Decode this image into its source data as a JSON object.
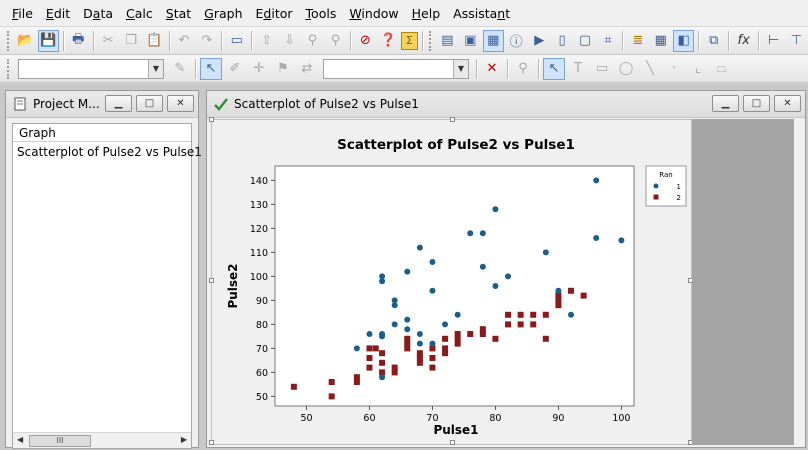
{
  "menubar": {
    "items": [
      {
        "pre": "",
        "u": "F",
        "post": "ile"
      },
      {
        "pre": "",
        "u": "E",
        "post": "dit"
      },
      {
        "pre": "D",
        "u": "a",
        "post": "ta"
      },
      {
        "pre": "",
        "u": "C",
        "post": "alc"
      },
      {
        "pre": "",
        "u": "S",
        "post": "tat"
      },
      {
        "pre": "",
        "u": "G",
        "post": "raph"
      },
      {
        "pre": "E",
        "u": "d",
        "post": "itor"
      },
      {
        "pre": "",
        "u": "T",
        "post": "ools"
      },
      {
        "pre": "",
        "u": "W",
        "post": "indow"
      },
      {
        "pre": "",
        "u": "H",
        "post": "elp"
      },
      {
        "pre": "Assista",
        "u": "n",
        "post": "t"
      }
    ]
  },
  "project_manager": {
    "title": "Project M...",
    "header": "Graph",
    "items": [
      "Scatterplot of Pulse2 vs Pulse1"
    ],
    "scroll_thumb": "III"
  },
  "graph_window": {
    "title": "Scatterplot of Pulse2 vs Pulse1"
  },
  "colors": {
    "series1": "#1a5e8c",
    "series2": "#8b1a1a"
  },
  "chart_data": {
    "type": "scatter",
    "title": "Scatterplot of Pulse2 vs Pulse1",
    "xlabel": "Pulse1",
    "ylabel": "Pulse2",
    "xlim": [
      45,
      102
    ],
    "ylim": [
      46,
      146
    ],
    "xticks": [
      50,
      60,
      70,
      80,
      90,
      100
    ],
    "yticks": [
      50,
      60,
      70,
      80,
      90,
      100,
      110,
      120,
      130,
      140
    ],
    "legend": {
      "title": "Ran",
      "placement": "right"
    },
    "series": [
      {
        "name": "1",
        "marker": "circle",
        "points": [
          [
            58,
            70
          ],
          [
            60,
            76
          ],
          [
            62,
            58
          ],
          [
            62,
            76
          ],
          [
            62,
            75
          ],
          [
            62,
            98
          ],
          [
            62,
            100
          ],
          [
            64,
            80
          ],
          [
            64,
            88
          ],
          [
            64,
            90
          ],
          [
            66,
            82
          ],
          [
            66,
            78
          ],
          [
            66,
            102
          ],
          [
            68,
            76
          ],
          [
            68,
            72
          ],
          [
            68,
            112
          ],
          [
            70,
            72
          ],
          [
            70,
            94
          ],
          [
            70,
            106
          ],
          [
            72,
            80
          ],
          [
            74,
            84
          ],
          [
            76,
            118
          ],
          [
            78,
            118
          ],
          [
            78,
            104
          ],
          [
            80,
            96
          ],
          [
            80,
            128
          ],
          [
            82,
            100
          ],
          [
            88,
            110
          ],
          [
            90,
            94
          ],
          [
            92,
            84
          ],
          [
            96,
            116
          ],
          [
            96,
            140
          ],
          [
            100,
            115
          ]
        ]
      },
      {
        "name": "2",
        "marker": "square",
        "points": [
          [
            48,
            54
          ],
          [
            54,
            50
          ],
          [
            54,
            56
          ],
          [
            58,
            56
          ],
          [
            58,
            58
          ],
          [
            60,
            62
          ],
          [
            60,
            66
          ],
          [
            60,
            70
          ],
          [
            61,
            70
          ],
          [
            62,
            60
          ],
          [
            62,
            64
          ],
          [
            62,
            68
          ],
          [
            64,
            60
          ],
          [
            64,
            62
          ],
          [
            66,
            70
          ],
          [
            66,
            72
          ],
          [
            66,
            74
          ],
          [
            68,
            64
          ],
          [
            68,
            66
          ],
          [
            68,
            68
          ],
          [
            70,
            62
          ],
          [
            70,
            66
          ],
          [
            70,
            70
          ],
          [
            72,
            68
          ],
          [
            72,
            70
          ],
          [
            72,
            74
          ],
          [
            74,
            72
          ],
          [
            74,
            74
          ],
          [
            74,
            76
          ],
          [
            76,
            76
          ],
          [
            78,
            76
          ],
          [
            78,
            78
          ],
          [
            80,
            74
          ],
          [
            82,
            80
          ],
          [
            82,
            84
          ],
          [
            84,
            80
          ],
          [
            84,
            84
          ],
          [
            86,
            80
          ],
          [
            86,
            84
          ],
          [
            88,
            84
          ],
          [
            88,
            74
          ],
          [
            90,
            88
          ],
          [
            90,
            90
          ],
          [
            90,
            92
          ],
          [
            92,
            94
          ],
          [
            94,
            92
          ]
        ]
      }
    ]
  }
}
